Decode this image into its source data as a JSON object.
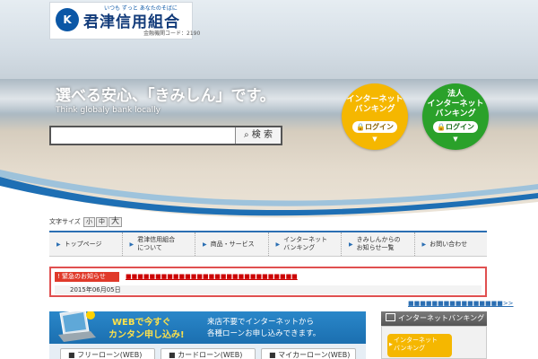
{
  "header": {
    "logo_mark": "K",
    "logo_tagline": "いつも ずっと あなたのそばに",
    "logo_name": "君津信用組合",
    "logo_code": "金融機関コード：2190"
  },
  "hero": {
    "tagline": "選べる安心、「きみしん」です。",
    "subtagline": "Think globaly bank locally"
  },
  "search": {
    "placeholder": "",
    "button_label": "検 索"
  },
  "banking": {
    "personal": {
      "title_line1": "インターネット",
      "title_line2": "バンキング",
      "login_label": "ログイン",
      "color": "#f5b700"
    },
    "corporate": {
      "title_line1": "法人",
      "title_line2": "インターネット",
      "title_line3": "バンキング",
      "login_label": "ログイン",
      "color": "#2aa12a"
    }
  },
  "font_size": {
    "label": "文字サイズ",
    "small": "小",
    "medium": "中",
    "large": "大"
  },
  "nav": {
    "items": [
      {
        "label": "トップページ",
        "label2": ""
      },
      {
        "label": "君津信用組合",
        "label2": "について"
      },
      {
        "label": "商品・サービス",
        "label2": ""
      },
      {
        "label": "インターネット",
        "label2": "バンキング"
      },
      {
        "label": "きみしんからの",
        "label2": "お知らせ一覧"
      },
      {
        "label": "お問い合わせ",
        "label2": ""
      }
    ]
  },
  "alert": {
    "badge": "緊急のお知らせ",
    "message": "■■■■■■■■■■■■■■■■■■■■■■■■■■■■■",
    "date": "2015年06月05日",
    "more_link": "■■■■■■■■■■■■■■■■>>"
  },
  "loan": {
    "banner_line1": "WEBで今すぐ",
    "banner_line2": "カンタン申し込み!",
    "desc_line1": "来店不要でインターネットから",
    "desc_line2": "各種ローンお申し込みできます。",
    "buttons": [
      "■ フリーローン(WEB)",
      "■ カードローン(WEB)",
      "■ マイカーローン(WEB)"
    ]
  },
  "side": {
    "header": "インターネットバンキング",
    "button_line1": "インターネット",
    "button_line2": "バンキング"
  },
  "colors": {
    "accent": "#2b6fb3",
    "alert": "#e03a2a",
    "brand": "#0b57a6"
  }
}
